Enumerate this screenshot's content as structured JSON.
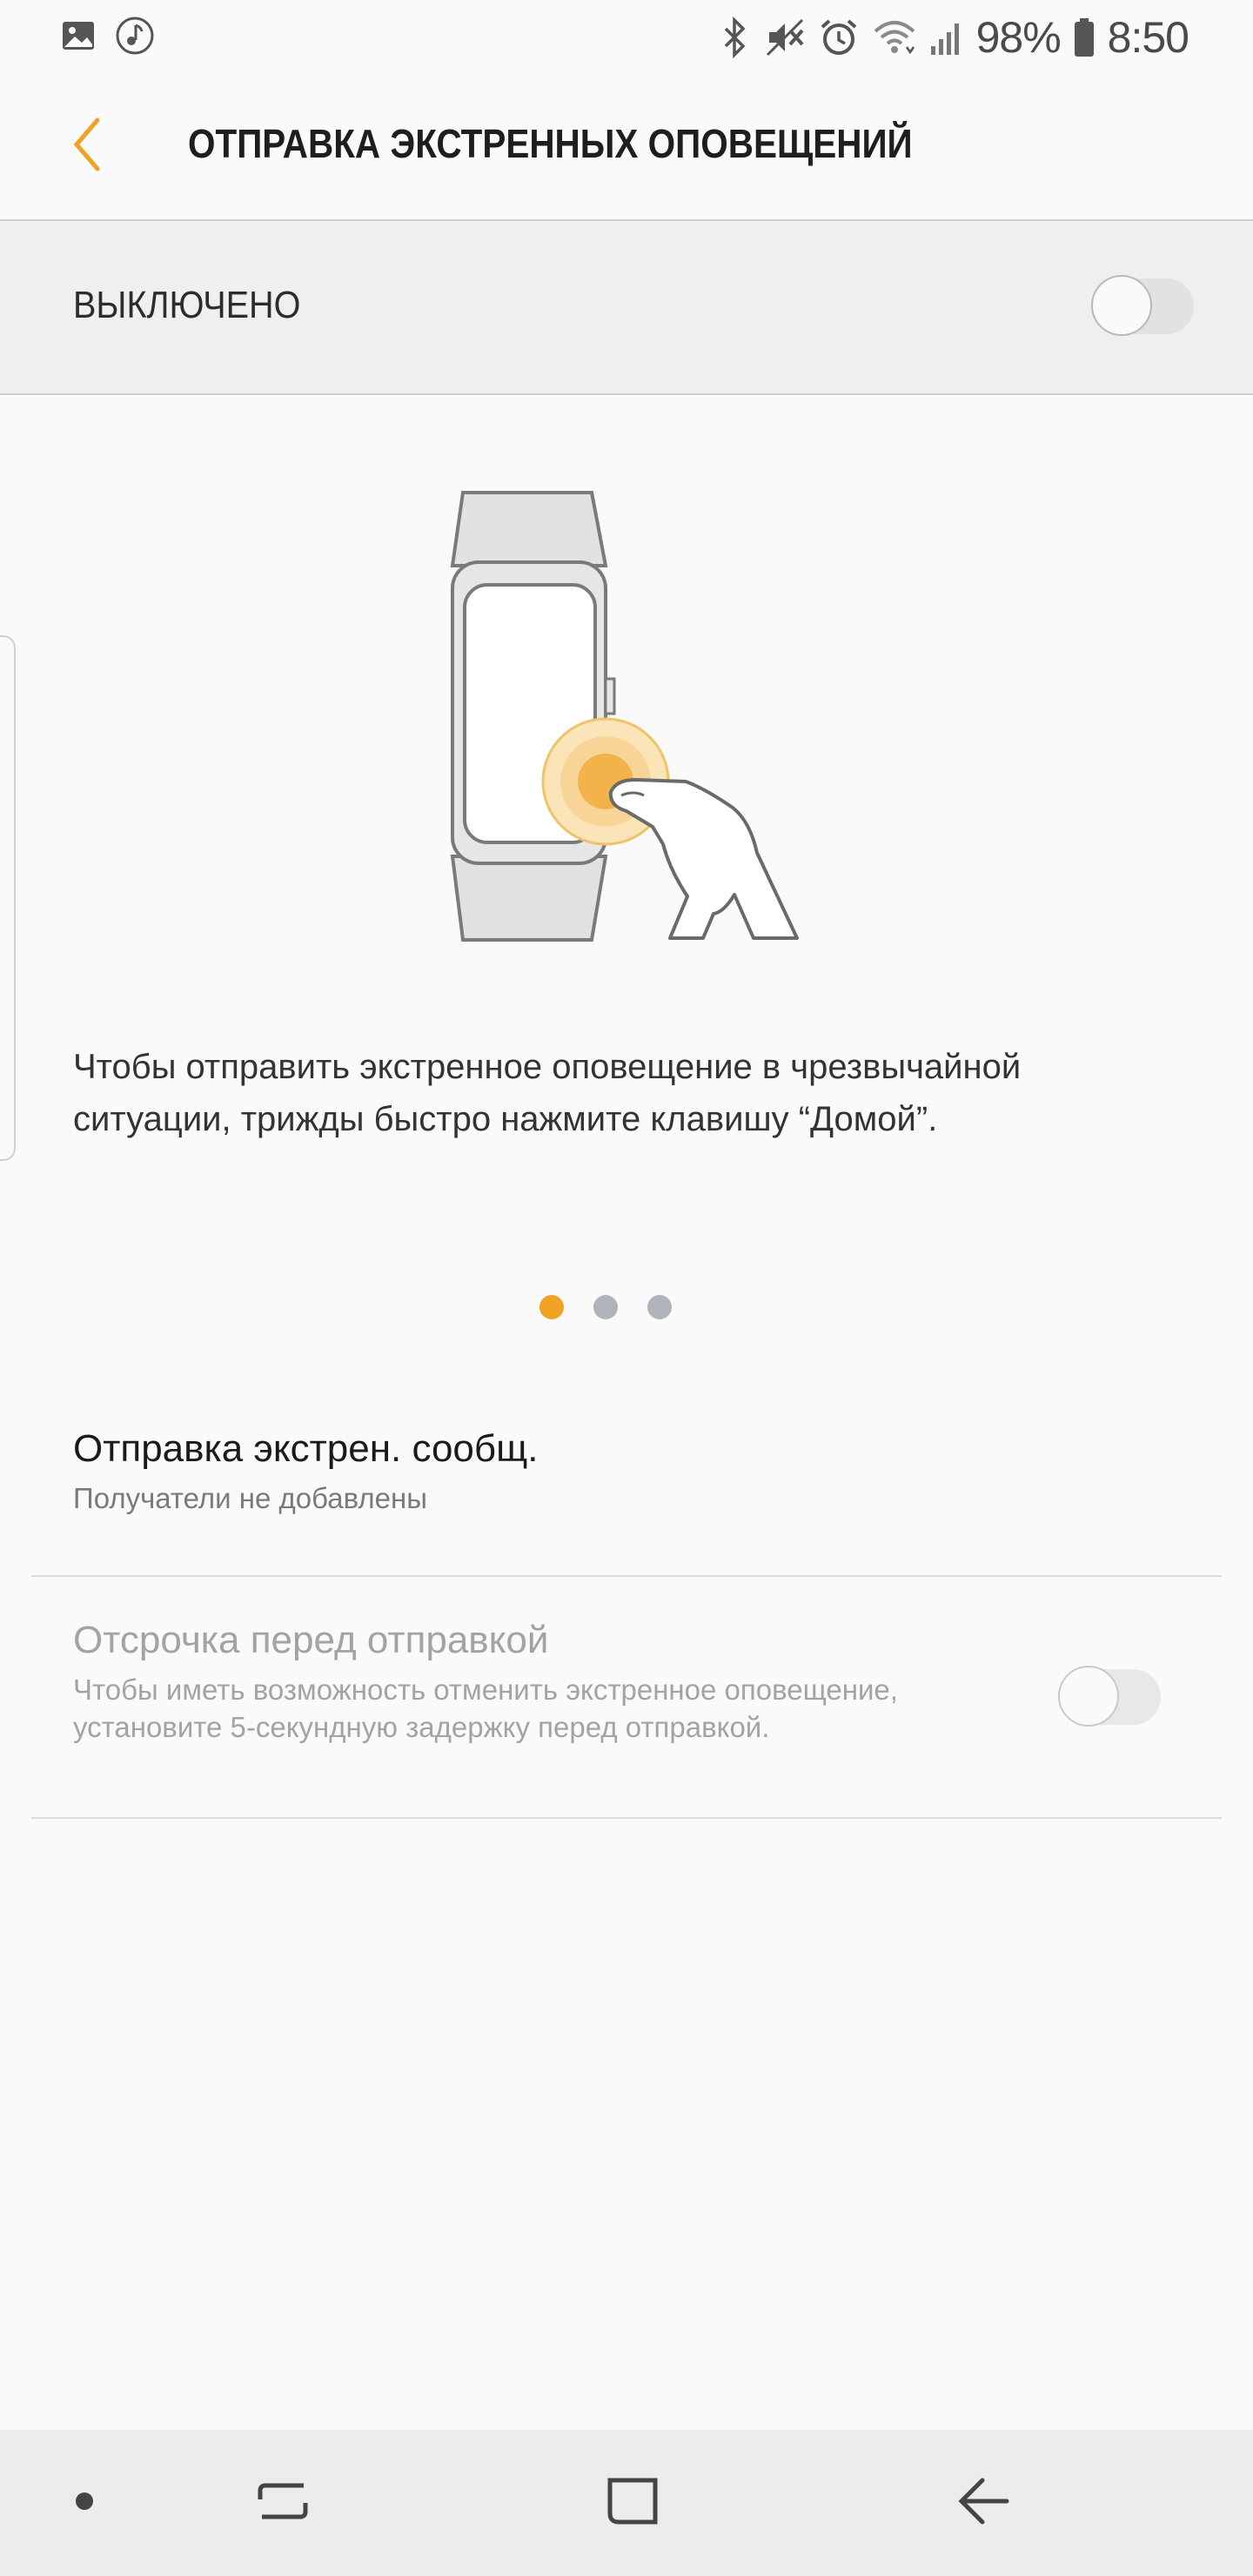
{
  "status_bar": {
    "icons_left": [
      "gallery-icon",
      "music-note-icon"
    ],
    "icons_right": [
      "bluetooth-icon",
      "vibrate-mute-icon",
      "alarm-icon",
      "wifi-icon",
      "signal-icon"
    ],
    "battery": "98%",
    "time": "8:50"
  },
  "header": {
    "title": "ОТПРАВКА ЭКСТРЕННЫХ ОПОВЕЩЕНИЙ",
    "back_icon": "chevron-left-icon"
  },
  "master_switch": {
    "label": "ВЫКЛЮЧЕНО",
    "enabled": false
  },
  "tutorial": {
    "description": "Чтобы отправить экстренное оповещение в чрезвычайной ситуации, трижды быстро нажмите клавишу “Домой”.",
    "pages": 3,
    "current_page": 1
  },
  "settings": {
    "send_messages": {
      "title": "Отправка экстрен. сообщ.",
      "summary": "Получатели не добавлены"
    },
    "delay": {
      "title": "Отсрочка перед отправкой",
      "summary": "Чтобы иметь возможность отменить экстренное оповещение, установите 5-секундную задержку перед отправкой.",
      "enabled": false
    }
  },
  "nav_bar": {
    "buttons": [
      "dot-icon",
      "recents-icon",
      "home-icon",
      "back-arrow-icon"
    ]
  },
  "colors": {
    "accent": "#f0a224",
    "background": "#fafafa",
    "switch_band": "#efefef"
  }
}
